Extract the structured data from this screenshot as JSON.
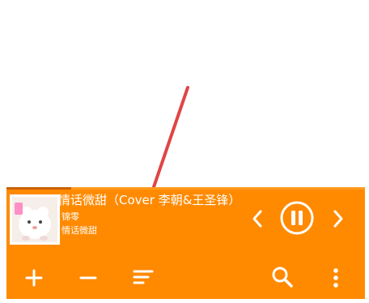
{
  "player": {
    "title": "情话微甜（Cover 李朝&王圣锋）",
    "artist": "锦零",
    "album": "情话微甜",
    "progress": 0.18
  },
  "colors": {
    "background": "#FF8A00",
    "progress": "#C86200",
    "text": "#FFFFFF",
    "arrow": "#E04545"
  },
  "icons": {
    "previous": "chevron-left-icon",
    "playPause": "pause-circle-icon",
    "next": "chevron-right-icon",
    "add": "plus-icon",
    "remove": "minus-icon",
    "playlist": "playlist-icon",
    "search": "search-icon",
    "more": "more-vertical-icon"
  }
}
